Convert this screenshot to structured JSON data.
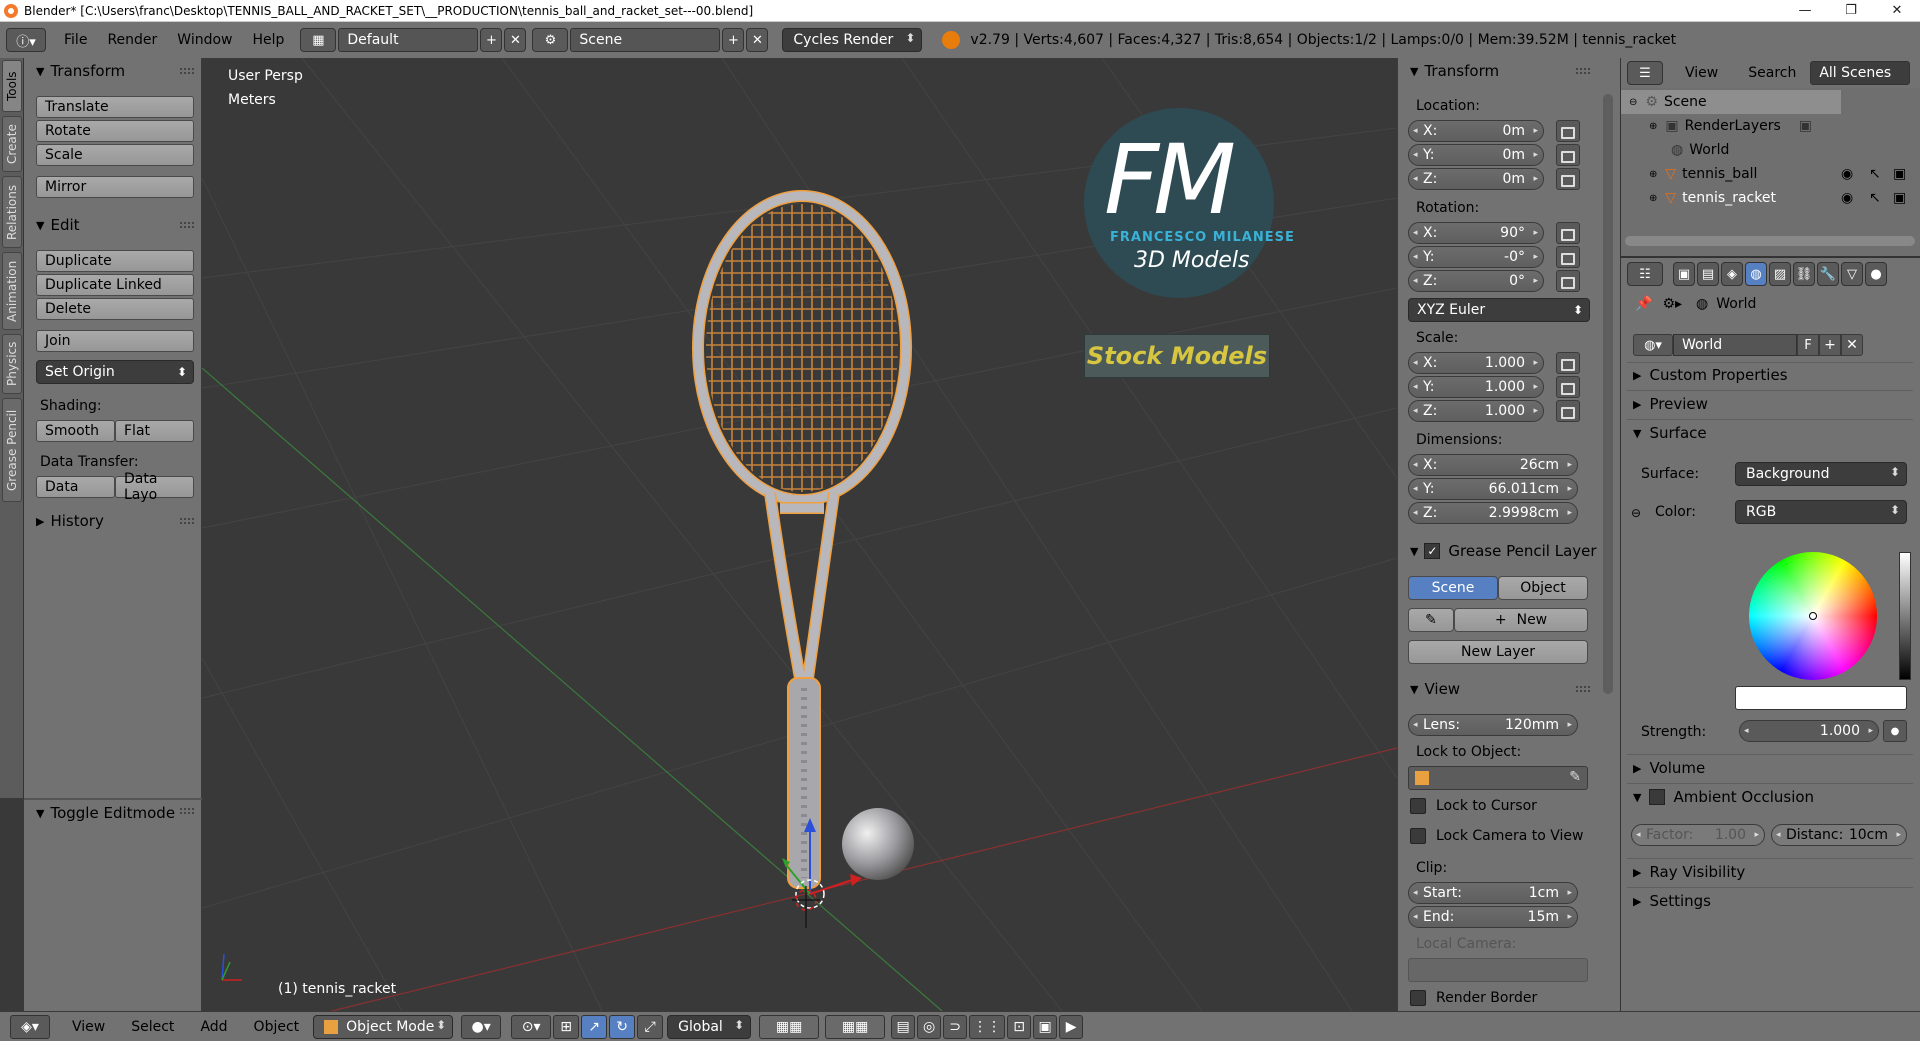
{
  "titlebar": {
    "title": "Blender* [C:\\Users\\franc\\Desktop\\TENNIS_BALL_AND_RACKET_SET\\__PRODUCTION\\tennis_ball_and_racket_set---00.blend]",
    "minimize": "—",
    "maximize": "❐",
    "close": "✕"
  },
  "infobar": {
    "menus": [
      "File",
      "Render",
      "Window",
      "Help"
    ],
    "screen_layout": "Default",
    "scene": "Scene",
    "engine": "Cycles Render",
    "stats": "v2.79 | Verts:4,607 | Faces:4,327 | Tris:8,654 | Objects:1/2 | Lamps:0/0 | Mem:39.52M | tennis_racket"
  },
  "tooltabs": [
    "Tools",
    "Create",
    "Relations",
    "Animation",
    "Physics",
    "Grease Pencil"
  ],
  "toolshelf": {
    "transform_title": "Transform",
    "translate": "Translate",
    "rotate": "Rotate",
    "scale": "Scale",
    "mirror": "Mirror",
    "edit_title": "Edit",
    "duplicate": "Duplicate",
    "duplicate_linked": "Duplicate Linked",
    "delete": "Delete",
    "join": "Join",
    "set_origin": "Set Origin",
    "shading_label": "Shading:",
    "smooth": "Smooth",
    "flat": "Flat",
    "data_transfer_label": "Data Transfer:",
    "data": "Data",
    "data_layout": "Data Layo",
    "history_title": "History",
    "toggle_editmode": "Toggle Editmode"
  },
  "viewport": {
    "view_name": "User Persp",
    "units": "Meters",
    "active_object": "(1) tennis_racket",
    "logo_letters": "FM",
    "logo_name": "FRANCESCO MILANESE",
    "logo_sub": "3D Models",
    "logo_banner": "Stock Models"
  },
  "npanel": {
    "transform_title": "Transform",
    "location_label": "Location:",
    "loc_x": "0m",
    "loc_y": "0m",
    "loc_z": "0m",
    "rotation_label": "Rotation:",
    "rot_x": "90°",
    "rot_y": "-0°",
    "rot_z": "0°",
    "rotation_mode": "XYZ Euler",
    "scale_label": "Scale:",
    "scale_x": "1.000",
    "scale_y": "1.000",
    "scale_z": "1.000",
    "dimensions_label": "Dimensions:",
    "dim_x": "26cm",
    "dim_y": "66.011cm",
    "dim_z": "2.9998cm",
    "axis_x": "X:",
    "axis_y": "Y:",
    "axis_z": "Z:",
    "grease_title": "Grease Pencil Layer",
    "scene_tab": "Scene",
    "object_tab": "Object",
    "new": "New",
    "new_layer": "New Layer",
    "view_title": "View",
    "lens_label": "Lens:",
    "lens": "120mm",
    "lock_to_object": "Lock to Object:",
    "lock_cursor": "Lock to Cursor",
    "lock_camera": "Lock Camera to View",
    "clip_label": "Clip:",
    "start_label": "Start:",
    "clip_start": "1cm",
    "end_label": "End:",
    "clip_end": "15m",
    "local_camera": "Local Camera:",
    "render_border": "Render Border"
  },
  "outliner": {
    "view": "View",
    "search": "Search",
    "scope": "All Scenes",
    "items": [
      "Scene",
      "RenderLayers",
      "World",
      "tennis_ball",
      "tennis_racket"
    ]
  },
  "properties": {
    "breadcrumb": "World",
    "world_name": "World",
    "fake_user": "F",
    "custom_properties": "Custom Properties",
    "preview": "Preview",
    "surface": "Surface",
    "surface_label": "Surface:",
    "surface_value": "Background",
    "color_label": "Color:",
    "color_value": "RGB",
    "strength_label": "Strength:",
    "strength": "1.000",
    "volume": "Volume",
    "ambient_occlusion": "Ambient Occlusion",
    "factor_label": "Factor:",
    "factor": "1.00",
    "distance_label": "Distanc:",
    "distance": "10cm",
    "ray_visibility": "Ray Visibility",
    "settings": "Settings"
  },
  "bottombar": {
    "view": "View",
    "select": "Select",
    "add": "Add",
    "object": "Object",
    "mode": "Object Mode",
    "orientation": "Global"
  },
  "colors": {
    "panel": "#727272",
    "viewport": "#393939",
    "accent_blue": "#5680c2",
    "selection_orange": "#f0a040"
  }
}
